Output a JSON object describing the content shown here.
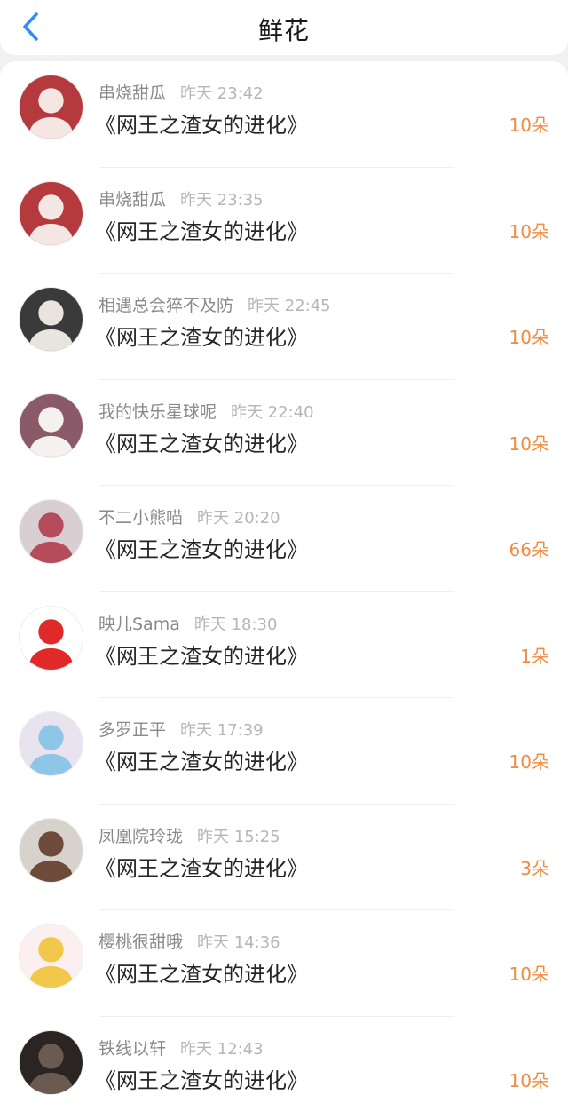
{
  "header": {
    "title": "鲜花"
  },
  "colors": {
    "accent_blue": "#2f8df5",
    "flower_orange": "#f28b3c"
  },
  "icons": {
    "back": "chevron-left-icon"
  },
  "records": [
    {
      "user": "串烧甜瓜",
      "time": "昨天 23:42",
      "book": "《网王之渣女的进化》",
      "flowers": "10朵",
      "avatar_bg": "#b53a3e",
      "avatar_fg": "#f3e6e3"
    },
    {
      "user": "串烧甜瓜",
      "time": "昨天 23:35",
      "book": "《网王之渣女的进化》",
      "flowers": "10朵",
      "avatar_bg": "#b53a3e",
      "avatar_fg": "#f3e6e3"
    },
    {
      "user": "相遇总会猝不及防",
      "time": "昨天 22:45",
      "book": "《网王之渣女的进化》",
      "flowers": "10朵",
      "avatar_bg": "#3a3a3a",
      "avatar_fg": "#e9e4de"
    },
    {
      "user": "我的快乐星球呢",
      "time": "昨天 22:40",
      "book": "《网王之渣女的进化》",
      "flowers": "10朵",
      "avatar_bg": "#8a5a6a",
      "avatar_fg": "#f4f1ee"
    },
    {
      "user": "不二小熊喵",
      "time": "昨天 20:20",
      "book": "《网王之渣女的进化》",
      "flowers": "66朵",
      "avatar_bg": "#d9cfd3",
      "avatar_fg": "#b54b5b"
    },
    {
      "user": "映儿Sama",
      "time": "昨天 18:30",
      "book": "《网王之渣女的进化》",
      "flowers": "1朵",
      "avatar_bg": "#ffffff",
      "avatar_fg": "#e02a2a"
    },
    {
      "user": "多罗正平",
      "time": "昨天 17:39",
      "book": "《网王之渣女的进化》",
      "flowers": "10朵",
      "avatar_bg": "#e9e2ef",
      "avatar_fg": "#8ec6e8"
    },
    {
      "user": "凤凰院玲珑",
      "time": "昨天 15:25",
      "book": "《网王之渣女的进化》",
      "flowers": "3朵",
      "avatar_bg": "#d8d2cc",
      "avatar_fg": "#6e4a3a"
    },
    {
      "user": "樱桃很甜哦",
      "time": "昨天 14:36",
      "book": "《网王之渣女的进化》",
      "flowers": "10朵",
      "avatar_bg": "#fbeff0",
      "avatar_fg": "#f2c84b"
    },
    {
      "user": "铁线以轩",
      "time": "昨天 12:43",
      "book": "《网王之渣女的进化》",
      "flowers": "10朵",
      "avatar_bg": "#2a2422",
      "avatar_fg": "#6b5a50"
    }
  ]
}
